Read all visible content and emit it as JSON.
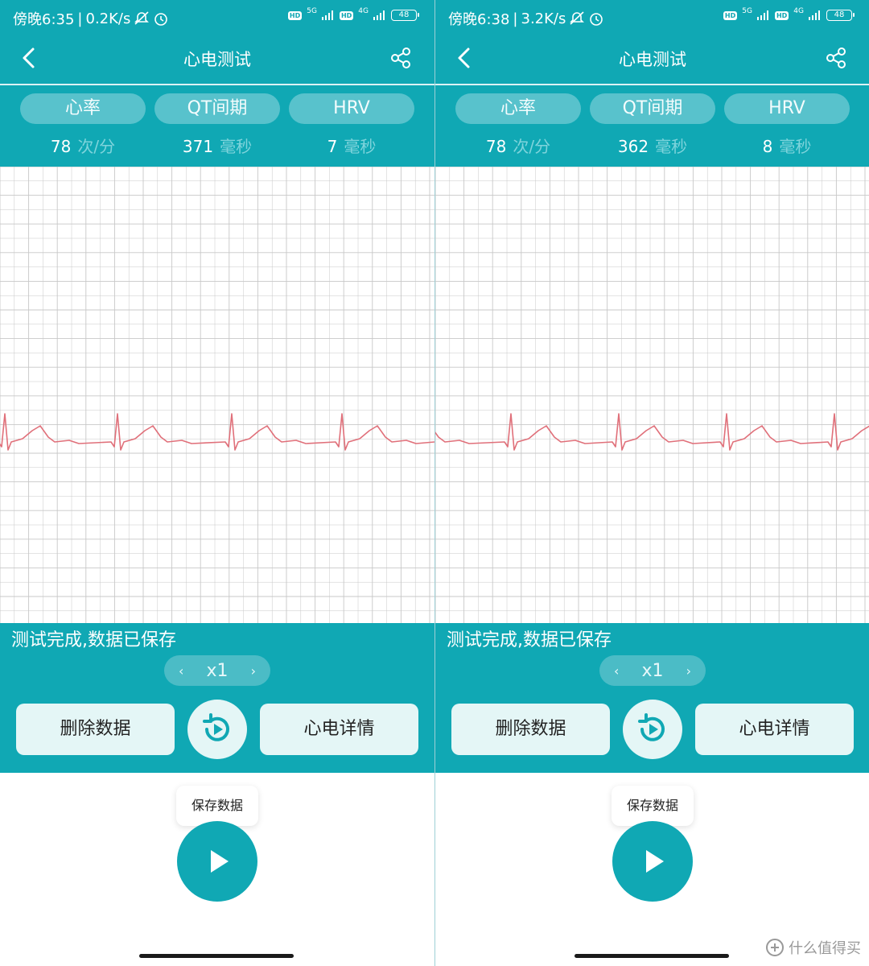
{
  "screens": [
    {
      "status": {
        "time": "傍晚6:35",
        "speed": "0.2K/s",
        "net5g": "5G",
        "net4g": "4G",
        "battery": "48"
      },
      "title": "心电测试",
      "tabs": [
        {
          "label": "心率"
        },
        {
          "label": "QT间期"
        },
        {
          "label": "HRV"
        }
      ],
      "metrics": [
        {
          "value": "78",
          "unit": "次/分"
        },
        {
          "value": "371",
          "unit": "毫秒"
        },
        {
          "value": "7",
          "unit": "毫秒"
        }
      ],
      "message": "测试完成,数据已保存",
      "speed": {
        "prev": "‹",
        "value": "x1",
        "next": "›"
      },
      "delete_label": "删除数据",
      "detail_label": "心电详情",
      "tooltip": "保存数据"
    },
    {
      "status": {
        "time": "傍晚6:38",
        "speed": "3.2K/s",
        "net5g": "5G",
        "net4g": "4G",
        "battery": "48"
      },
      "title": "心电测试",
      "tabs": [
        {
          "label": "心率"
        },
        {
          "label": "QT间期"
        },
        {
          "label": "HRV"
        }
      ],
      "metrics": [
        {
          "value": "78",
          "unit": "次/分"
        },
        {
          "value": "362",
          "unit": "毫秒"
        },
        {
          "value": "8",
          "unit": "毫秒"
        }
      ],
      "message": "测试完成,数据已保存",
      "speed": {
        "prev": "‹",
        "value": "x1",
        "next": "›"
      },
      "delete_label": "删除数据",
      "detail_label": "心电详情",
      "tooltip": "保存数据"
    }
  ],
  "watermark": "什么值得买",
  "colors": {
    "teal": "#10a8b4",
    "ecg": "#e0707a",
    "grid": "#c8c8c8"
  },
  "icons": [
    "back-arrow-icon",
    "share-icon",
    "replay-icon",
    "play-icon",
    "alarm-icon",
    "mute-icon"
  ]
}
